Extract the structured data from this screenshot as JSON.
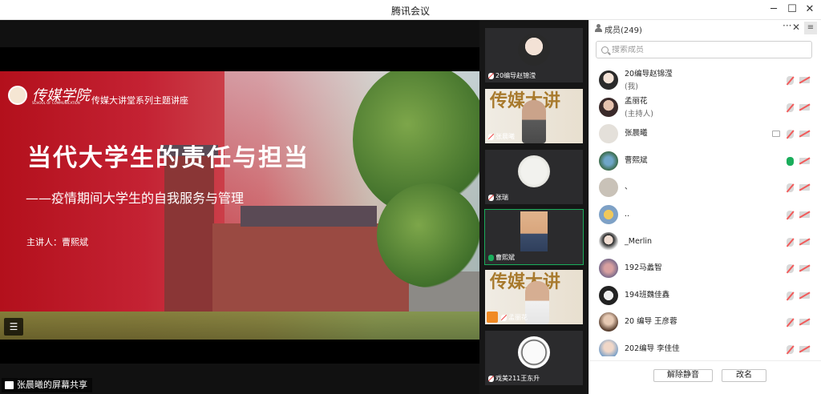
{
  "window": {
    "title": "腾讯会议"
  },
  "slide": {
    "logo_text": "传媒学院",
    "logo_sub": "SCHOOL OF COMMUNICATION",
    "series": "传媒大讲堂系列主题讲座",
    "title": "当代大学生的责任与担当",
    "subtitle": "——疫情期间大学生的自我服务与管理",
    "speaker": "主讲人：曹熙斌"
  },
  "share_tag": "张晨曦的屏幕共享",
  "video_tiles": [
    {
      "name": "20编导赵锦滢",
      "mic": "muted",
      "kind": "avatar"
    },
    {
      "name": "张晨曦",
      "mic": "muted",
      "kind": "camera",
      "calligraphy": "传媒大讲"
    },
    {
      "name": "张瑞",
      "mic": "muted",
      "kind": "avatar"
    },
    {
      "name": "曹熙斌",
      "mic": "on",
      "kind": "camera-plain",
      "active": true
    },
    {
      "name": "孟丽花",
      "mic": "muted",
      "kind": "camera",
      "calligraphy": "传媒大讲",
      "host": true
    },
    {
      "name": "戏美211王东升",
      "mic": "muted",
      "kind": "avatar"
    }
  ],
  "panel": {
    "label": "成员(249)",
    "search_placeholder": "搜索成员",
    "members": [
      {
        "name": "20编导赵锦滢",
        "role": "(我)",
        "mic": "muted"
      },
      {
        "name": "孟丽花",
        "role": "(主持人)",
        "mic": "muted"
      },
      {
        "name": "张晨曦",
        "role": "",
        "mic": "muted",
        "sharing": true
      },
      {
        "name": "曹熙斌",
        "role": "",
        "mic": "on"
      },
      {
        "name": "、",
        "role": "",
        "mic": "muted"
      },
      {
        "name": "..",
        "role": "",
        "mic": "muted"
      },
      {
        "name": "_Merlin",
        "role": "",
        "mic": "muted"
      },
      {
        "name": "192马蠡智",
        "role": "",
        "mic": "muted"
      },
      {
        "name": "194班魏佳鑫",
        "role": "",
        "mic": "muted"
      },
      {
        "name": "20 编导 王彦蓉",
        "role": "",
        "mic": "muted"
      },
      {
        "name": "202编导 李佳佳",
        "role": "",
        "mic": "muted"
      }
    ],
    "unmute_all": "解除静音",
    "rename": "改名"
  },
  "colors": {
    "accent_green": "#1aad5b",
    "mute_red": "#f15b5b",
    "host_orange": "#f08a24"
  }
}
